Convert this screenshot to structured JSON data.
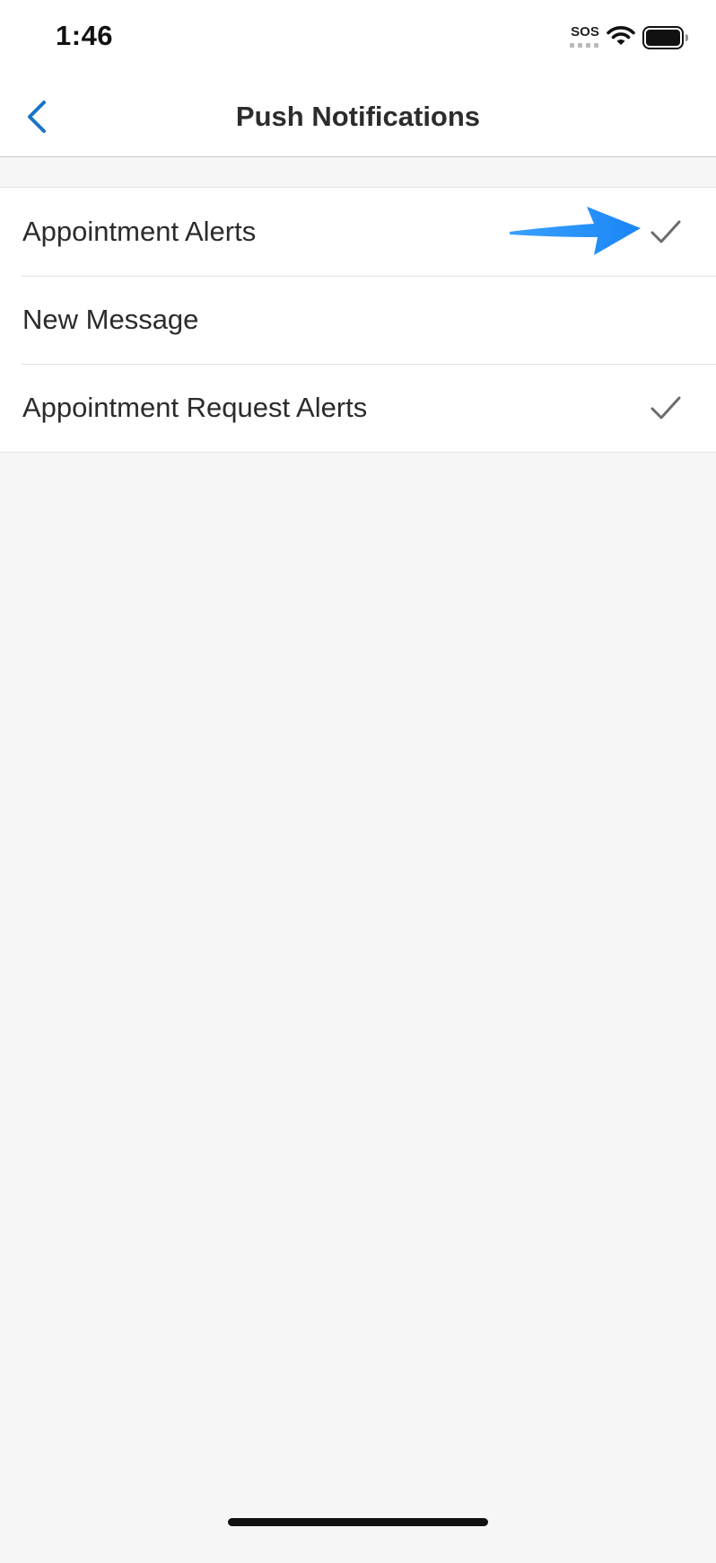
{
  "status_bar": {
    "time": "1:46",
    "carrier": "SOS"
  },
  "nav": {
    "title": "Push Notifications",
    "back_icon": "chevron-left-icon",
    "accent_color": "#1a73c8"
  },
  "settings": {
    "items": [
      {
        "label": "Appointment Alerts",
        "checked": true
      },
      {
        "label": "New Message",
        "checked": false
      },
      {
        "label": "Appointment Request Alerts",
        "checked": true
      }
    ]
  },
  "annotation": {
    "icon": "arrow-right-icon",
    "color": "#1e90ff"
  }
}
